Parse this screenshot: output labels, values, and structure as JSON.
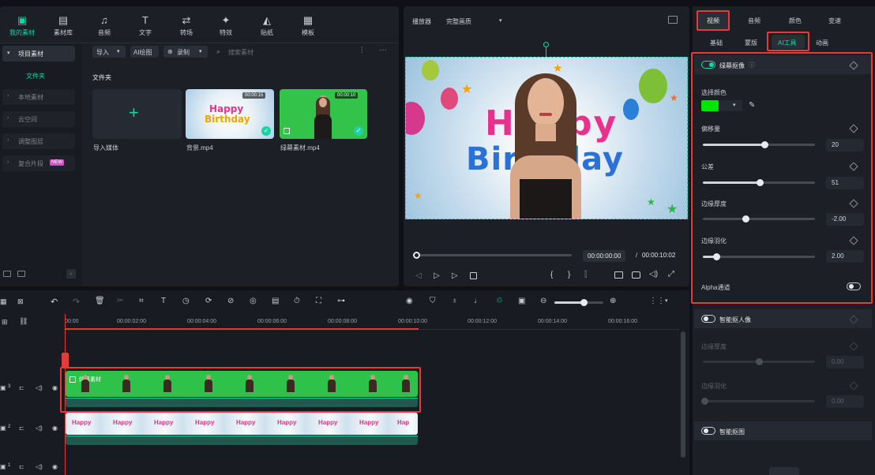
{
  "top_toolbar": {
    "items": [
      {
        "label": "我的素材",
        "icon": "folder-icon",
        "active": true
      },
      {
        "label": "素材库",
        "icon": "library-icon"
      },
      {
        "label": "音频",
        "icon": "music-note-icon"
      },
      {
        "label": "文字",
        "icon": "text-icon"
      },
      {
        "label": "转场",
        "icon": "transition-icon"
      },
      {
        "label": "特效",
        "icon": "effects-icon"
      },
      {
        "label": "贴纸",
        "icon": "sticker-icon"
      },
      {
        "label": "模板",
        "icon": "template-icon"
      }
    ]
  },
  "media_sidebar": {
    "items": [
      {
        "label": "项目素材",
        "active": true
      },
      {
        "label": "文件夹",
        "selected": true
      },
      {
        "label": "本地素材"
      },
      {
        "label": "云空间"
      },
      {
        "label": "调整图层"
      },
      {
        "label": "复合片段",
        "badge": "NEW"
      }
    ]
  },
  "media_toolbar": {
    "import_label": "导入",
    "ai_image_label": "AI绘图",
    "record_label": "录制",
    "search_placeholder": "搜索素材"
  },
  "media_area": {
    "folder_title": "文件夹",
    "clips": [
      {
        "name": "导入媒体",
        "type": "import"
      },
      {
        "name": "背景.mp4",
        "duration": "00:00:15",
        "type": "birthday"
      },
      {
        "name": "绿幕素材.mp4",
        "duration": "00:00:10",
        "type": "greenscreen"
      }
    ]
  },
  "preview": {
    "player_label": "播放器",
    "quality_label": "完整画质",
    "birthday_text_1": "Happy",
    "birthday_text_2": "Birthday",
    "current_time": "00:00:00:00",
    "separator": "/",
    "total_time": "00:00:10:02",
    "progress": 0
  },
  "right_panel": {
    "main_tabs": [
      {
        "label": "视频",
        "active": true
      },
      {
        "label": "音频"
      },
      {
        "label": "颜色"
      },
      {
        "label": "变速"
      }
    ],
    "sub_tabs": [
      {
        "label": "基础"
      },
      {
        "label": "蒙版"
      },
      {
        "label": "AI工具",
        "active": true
      },
      {
        "label": "动画"
      }
    ],
    "chroma_key": {
      "title": "绿幕抠像",
      "enabled": true,
      "select_color_label": "选择颜色",
      "select_color": "#00e600",
      "params": [
        {
          "label": "偏移量",
          "value": "20",
          "level": 0.55
        },
        {
          "label": "公差",
          "value": "51",
          "level": 0.51
        },
        {
          "label": "边缘厚度",
          "value": "-2.00",
          "level": 0.38
        },
        {
          "label": "边缘羽化",
          "value": "2.00",
          "level": 0.12
        }
      ],
      "alpha_label": "Alpha通道",
      "alpha_enabled": false
    },
    "smart_cutout": {
      "title": "智能抠人像",
      "params": [
        {
          "label": "边缘厚度",
          "value": "0.00",
          "level": 0.5
        },
        {
          "label": "边缘羽化",
          "value": "0.00",
          "level": 0.0
        }
      ]
    },
    "smart_mask": {
      "title": "智能抠图"
    }
  },
  "timeline": {
    "ruler_ticks": [
      "00:00",
      "00:00:02:00",
      "00:00:04:00",
      "00:00:06:00",
      "00:00:08:00",
      "00:00:10:00",
      "00:00:12:00",
      "00:00:14:00",
      "00:00:16:00"
    ],
    "tracks": [
      {
        "number": "3"
      },
      {
        "number": "2"
      },
      {
        "number": "1"
      }
    ],
    "clip_green_label": "绿幕素材",
    "colors": {
      "accent": "#1fd1a5",
      "red_highlight": "#e23b3b",
      "greenscreen": "#2fc24a"
    }
  }
}
